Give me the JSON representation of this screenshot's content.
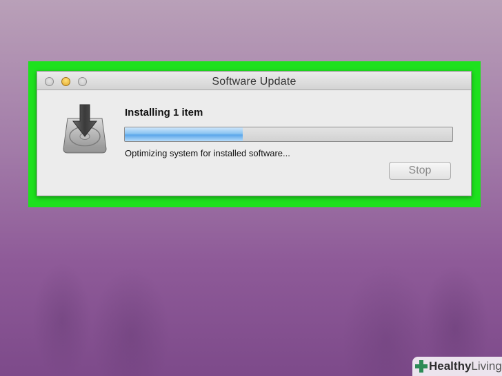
{
  "window": {
    "title": "Software Update",
    "traffic_lights": [
      "close",
      "minimize",
      "zoom"
    ]
  },
  "install": {
    "heading": "Installing 1 item",
    "status": "Optimizing system for installed software...",
    "progress_fraction": 0.36,
    "icon": "hard-disk-download-icon"
  },
  "buttons": {
    "stop_label": "Stop"
  },
  "watermark": {
    "bold": "Healthy",
    "light": "Living",
    "icon": "plus-cross-icon"
  },
  "colors": {
    "highlight": "#1ee11e",
    "progress": "#5aa6ea",
    "minimize_button": "#e2a92b"
  }
}
